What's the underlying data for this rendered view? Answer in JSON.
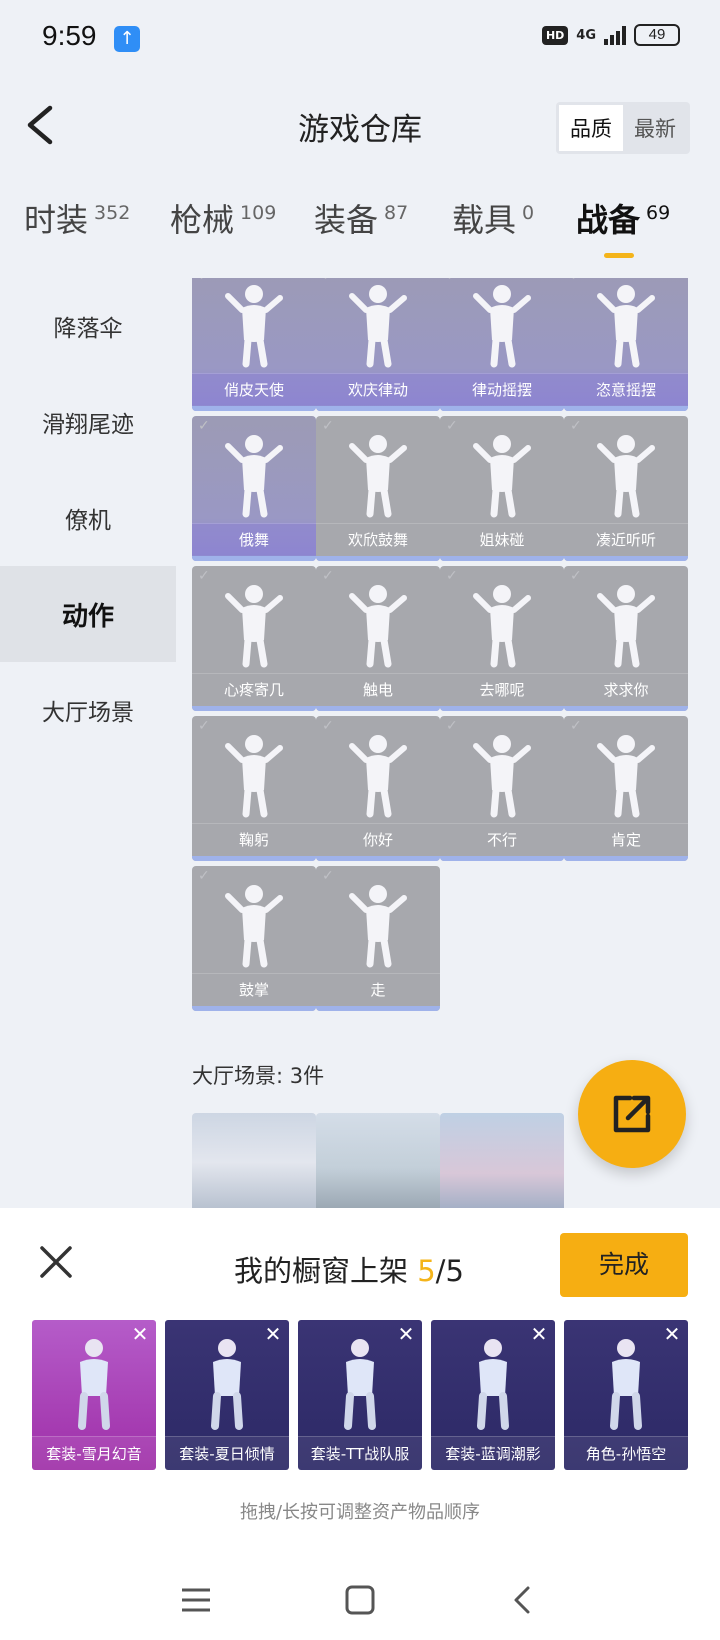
{
  "status_bar": {
    "time": "9:59",
    "network": "4G",
    "battery": "49"
  },
  "header": {
    "title": "游戏仓库",
    "sort_options": [
      "品质",
      "最新"
    ],
    "sort_selected": "品质"
  },
  "tabs": [
    {
      "label": "时装",
      "count": "352"
    },
    {
      "label": "枪械",
      "count": "109"
    },
    {
      "label": "装备",
      "count": "87"
    },
    {
      "label": "载具",
      "count": "0"
    },
    {
      "label": "战备",
      "count": "69"
    }
  ],
  "sidebar": [
    {
      "label": "降落伞"
    },
    {
      "label": "滑翔尾迹"
    },
    {
      "label": "僚机"
    },
    {
      "label": "动作"
    },
    {
      "label": "大厅场景"
    }
  ],
  "actions": [
    {
      "name": "俏皮天使",
      "rarity": "purple"
    },
    {
      "name": "欢庆律动",
      "rarity": "purple"
    },
    {
      "name": "律动摇摆",
      "rarity": "purple"
    },
    {
      "name": "恣意摇摆",
      "rarity": "purple"
    },
    {
      "name": "俄舞",
      "rarity": "purple"
    },
    {
      "name": "欢欣鼓舞",
      "rarity": "grey"
    },
    {
      "name": "姐妹碰",
      "rarity": "grey"
    },
    {
      "name": "凑近听听",
      "rarity": "grey"
    },
    {
      "name": "心疼寄几",
      "rarity": "grey"
    },
    {
      "name": "触电",
      "rarity": "grey"
    },
    {
      "name": "去哪呢",
      "rarity": "grey"
    },
    {
      "name": "求求你",
      "rarity": "grey"
    },
    {
      "name": "鞠躬",
      "rarity": "grey"
    },
    {
      "name": "你好",
      "rarity": "grey"
    },
    {
      "name": "不行",
      "rarity": "grey"
    },
    {
      "name": "肯定",
      "rarity": "grey"
    },
    {
      "name": "鼓掌",
      "rarity": "grey"
    },
    {
      "name": "走",
      "rarity": "grey"
    }
  ],
  "lobby_section": {
    "label": "大厅场景: 3件"
  },
  "showcase": {
    "title_prefix": "我的橱窗上架 ",
    "count": "5",
    "total": "/5",
    "done_label": "完成",
    "items": [
      {
        "name": "套装-雪月幻音"
      },
      {
        "name": "套装-夏日倾情"
      },
      {
        "name": "套装-TT战队服"
      },
      {
        "name": "套装-蓝调潮影"
      },
      {
        "name": "角色-孙悟空"
      }
    ],
    "hint": "拖拽/长按可调整资产物品顺序"
  },
  "colors": {
    "accent": "#f6ae12",
    "purple_rarity": "#9a98c4",
    "grey_rarity": "#a7a8ad"
  }
}
